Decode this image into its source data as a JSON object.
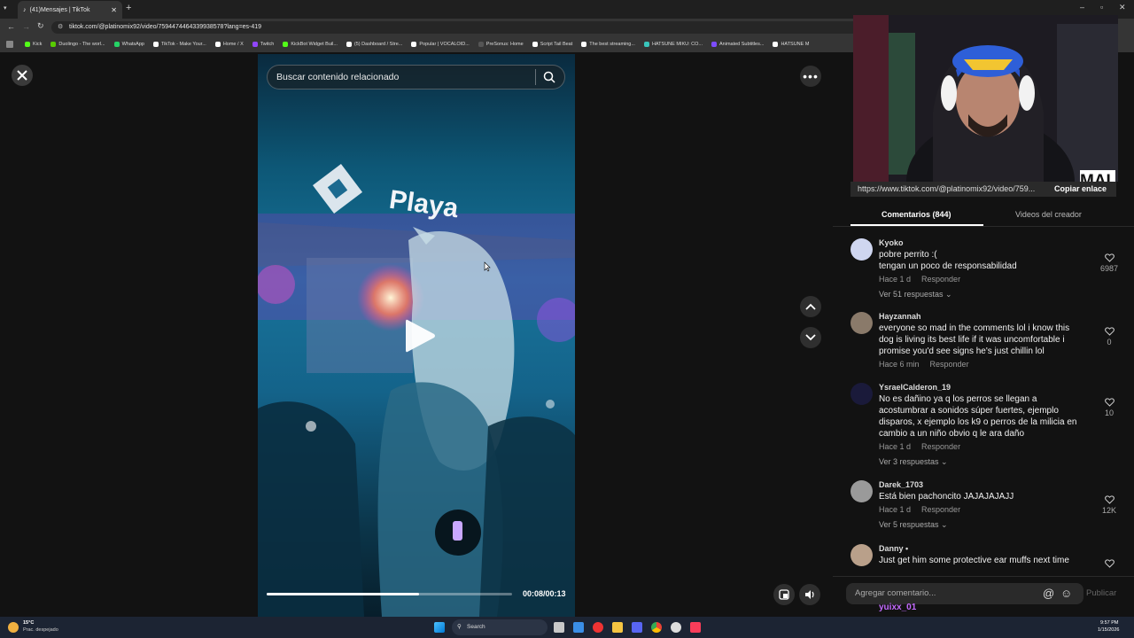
{
  "browser": {
    "tab_title": "(41)Mensajes | TikTok",
    "url": "tiktok.com/@platinomix92/video/7594474464339938578?lang=es-419",
    "bookmarks": [
      {
        "label": "Kick",
        "color": "#53fc18"
      },
      {
        "label": "Duolingo - The worl...",
        "color": "#58cc02"
      },
      {
        "label": "WhatsApp",
        "color": "#25d366"
      },
      {
        "label": "TikTok - Make Your...",
        "color": "#ffffff"
      },
      {
        "label": "Home / X",
        "color": "#ffffff"
      },
      {
        "label": "Twitch",
        "color": "#9146ff"
      },
      {
        "label": "KickBot Widget Buil...",
        "color": "#53fc18"
      },
      {
        "label": "(5) Dashboard / Stre...",
        "color": "#ffffff"
      },
      {
        "label": "Popular | VOCALOID...",
        "color": "#ffffff"
      },
      {
        "label": "PreSonus: Home",
        "color": "#555555"
      },
      {
        "label": "Script Tail Beat",
        "color": "#ffffff"
      },
      {
        "label": "The best streaming...",
        "color": "#ffffff"
      },
      {
        "label": "HATSUNE MIKU: CO...",
        "color": "#39c5bb"
      },
      {
        "label": "Animated Subtitles...",
        "color": "#7d4cff"
      },
      {
        "label": "HATSUNE M",
        "color": "#ffffff"
      }
    ]
  },
  "video": {
    "search_placeholder": "Buscar contenido relacionado",
    "stage_text": "Playa",
    "timecode": "00:08/00:13",
    "progress": 0.62
  },
  "webcam": {
    "overlay_text": "MAI",
    "copy_url": "https://www.tiktok.com/@platinomix92/video/759...",
    "copy_label": "Copiar enlace"
  },
  "panel": {
    "tab_comments": "Comentarios (844)",
    "tab_creator": "Videos del creador",
    "comment_placeholder": "Agregar comentario...",
    "publish_label": "Publicar",
    "chat_user": "yuixx_01"
  },
  "comments": [
    {
      "user": "Kyoko",
      "lines": [
        "pobre perrito :(",
        "tengan un poco de responsabilidad"
      ],
      "time": "Hace 1 d",
      "reply": "Responder",
      "likes": "6987",
      "replies": "Ver 51 respuestas",
      "avatar": "#cfd6f0"
    },
    {
      "user": "Hayzannah",
      "lines": [
        "everyone so mad in the comments lol i know this",
        "dog is living its best life if it was uncomfortable i",
        "promise you'd see signs he's just chillin lol"
      ],
      "time": "Hace 6 min",
      "reply": "Responder",
      "likes": "0",
      "replies": "",
      "avatar": "#8a7a6a"
    },
    {
      "user": "YsraelCalderon_19",
      "lines": [
        "No es dañino ya q los perros se llegan a",
        "acostumbrar a sonidos súper fuertes, ejemplo",
        "disparos, x ejemplo los k9 o perros de la milicia en",
        "cambio a un niño obvio q le ara daño"
      ],
      "time": "Hace 1 d",
      "reply": "Responder",
      "likes": "10",
      "replies": "Ver 3 respuestas",
      "avatar": "#1a1a3a"
    },
    {
      "user": "Darek_1703",
      "lines": [
        "Está bien pachoncito JAJAJAJAJJ"
      ],
      "time": "Hace 1 d",
      "reply": "Responder",
      "likes": "12K",
      "replies": "Ver 5 respuestas",
      "avatar": "#9a9a9a"
    },
    {
      "user": "Danny •",
      "lines": [
        "Just get him some protective ear muffs next time"
      ],
      "time": "",
      "reply": "",
      "likes": "",
      "replies": "",
      "avatar": "#b9a08a"
    }
  ],
  "taskbar": {
    "weather_temp": "15°C",
    "weather_desc": "Prac. despejado",
    "search_label": "Search",
    "time": "9:57 PM",
    "date": "1/15/2026"
  }
}
